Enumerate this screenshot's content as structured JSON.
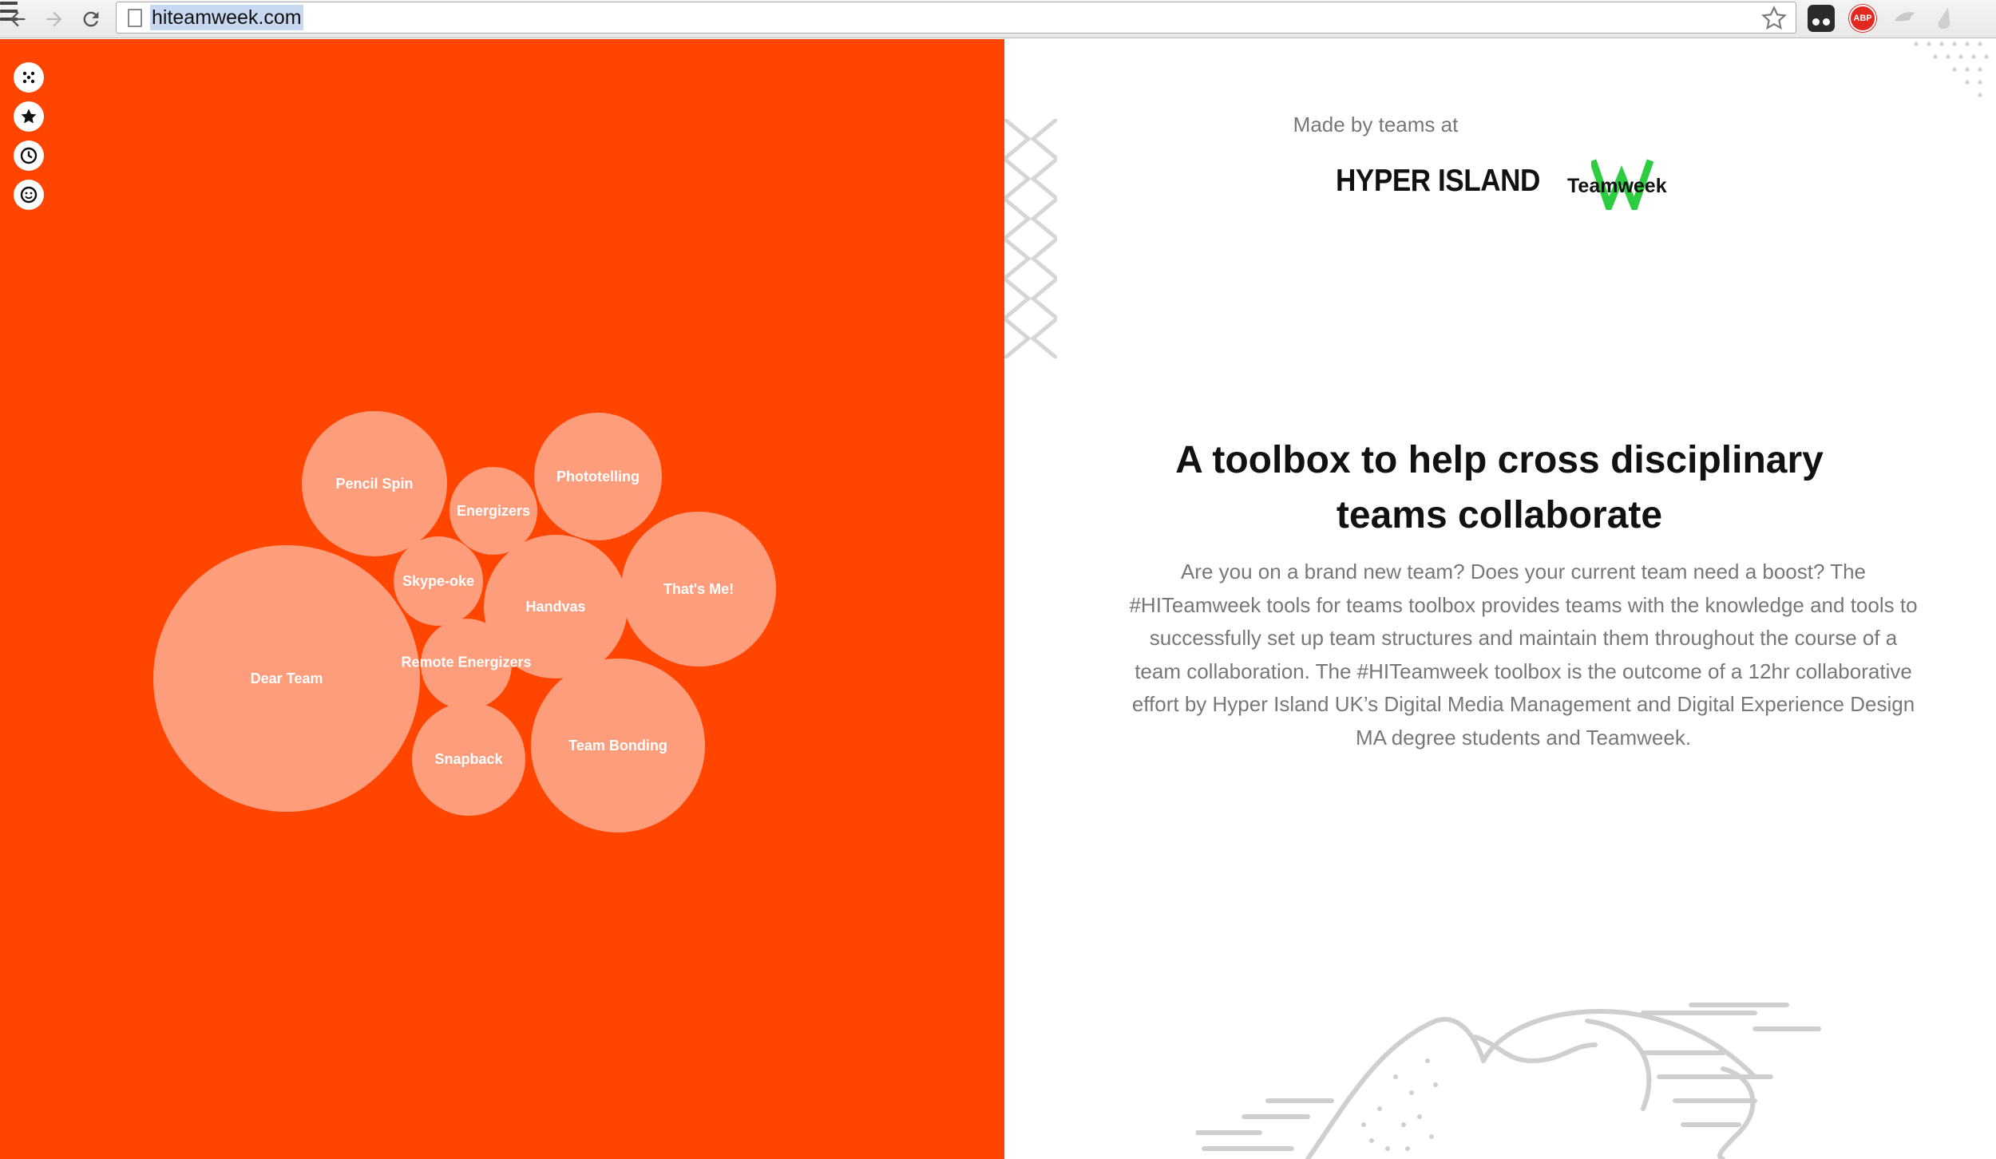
{
  "browser": {
    "url": "hiteamweek.com",
    "extensions": [
      "ghostery-icon",
      "adblock-plus-icon",
      "bird-extension-icon",
      "drop-extension-icon"
    ],
    "abp_label": "ABP"
  },
  "sidebar": {
    "items": [
      {
        "name": "dice-icon"
      },
      {
        "name": "star-icon"
      },
      {
        "name": "clock-icon"
      },
      {
        "name": "smiley-icon"
      }
    ]
  },
  "bubbles": [
    {
      "label": "Pencil Spin"
    },
    {
      "label": "Energizers"
    },
    {
      "label": "Phototelling"
    },
    {
      "label": "Skype-oke"
    },
    {
      "label": "Handvas"
    },
    {
      "label": "That's Me!"
    },
    {
      "label": "Dear Team"
    },
    {
      "label": "Remote Energizers"
    },
    {
      "label": "Snapback"
    },
    {
      "label": "Team Bonding"
    }
  ],
  "hero": {
    "made_by": "Made by teams at",
    "logo_hyper_island": "HYPER ISLAND",
    "logo_teamweek": "Teamweek",
    "headline": "A toolbox to help cross disciplinary teams collaborate",
    "body": "Are you on a brand new team? Does your current team need a boost? The #HITeamweek tools for teams toolbox provides teams with the knowledge and tools to successfully set up team structures and maintain them throughout the course of a team collaboration. The #HITeamweek toolbox is the outcome of a 12hr collaborative effort by Hyper Island UK’s Digital Media Management and Digital Experience Design MA degree students and Teamweek."
  },
  "colors": {
    "panel": "#ff4500",
    "bubble": "#fd9d7b",
    "teamweek_green": "#2ecc40"
  }
}
